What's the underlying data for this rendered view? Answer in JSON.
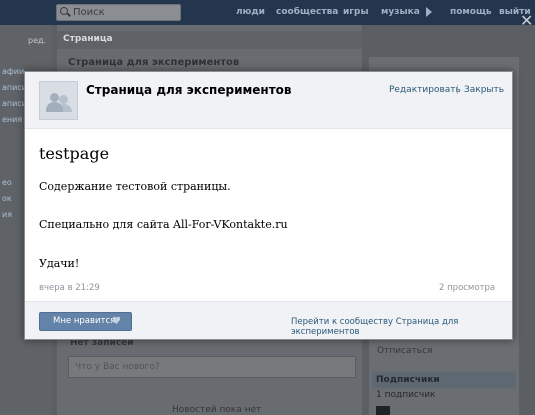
{
  "topbar": {
    "search_placeholder": "Поиск",
    "nav": [
      "люди",
      "сообщества",
      "игры",
      "музыка",
      "помощь",
      "выйти"
    ]
  },
  "left": {
    "items": [
      "ред.",
      "афии",
      "аписи",
      "аписи",
      "ения",
      "ео",
      "ок",
      "ия"
    ]
  },
  "background": {
    "section_label": "Страница",
    "page_title": "Страница для экспериментов",
    "no_posts": "Нет записей",
    "post_placeholder": "Что у Вас нового?",
    "no_news": "Новостей пока нет",
    "unsubscribe": "Отписаться",
    "subscribers_label": "Подписчики",
    "subscribers_count": "1 подписчик"
  },
  "modal": {
    "title": "Страница для экспериментов",
    "edit_link": "Редактировать",
    "link_separator": "|",
    "close_link": "Закрыть",
    "wiki_title": "testpage",
    "lines": [
      "Содержание тестовой страницы.",
      "Специально для сайта All-For-VKontakte.ru",
      "Удачи!"
    ],
    "date": "вчера в 21:29",
    "views": "2 просмотра",
    "like_button": "Мне нравится",
    "heart_icon": "♥",
    "community_link": "Перейти к сообществу Страница для экспериментов"
  },
  "colors": {
    "topbar": "#24364d",
    "link": "#2b587a",
    "like_button": "#6383a8",
    "overlay_bg": "#5b5e62"
  },
  "icons": {
    "search": "search-icon",
    "close": "close-icon",
    "avatar": "community-avatar-icon",
    "heart": "heart-icon",
    "more": "play-arrow-icon"
  }
}
